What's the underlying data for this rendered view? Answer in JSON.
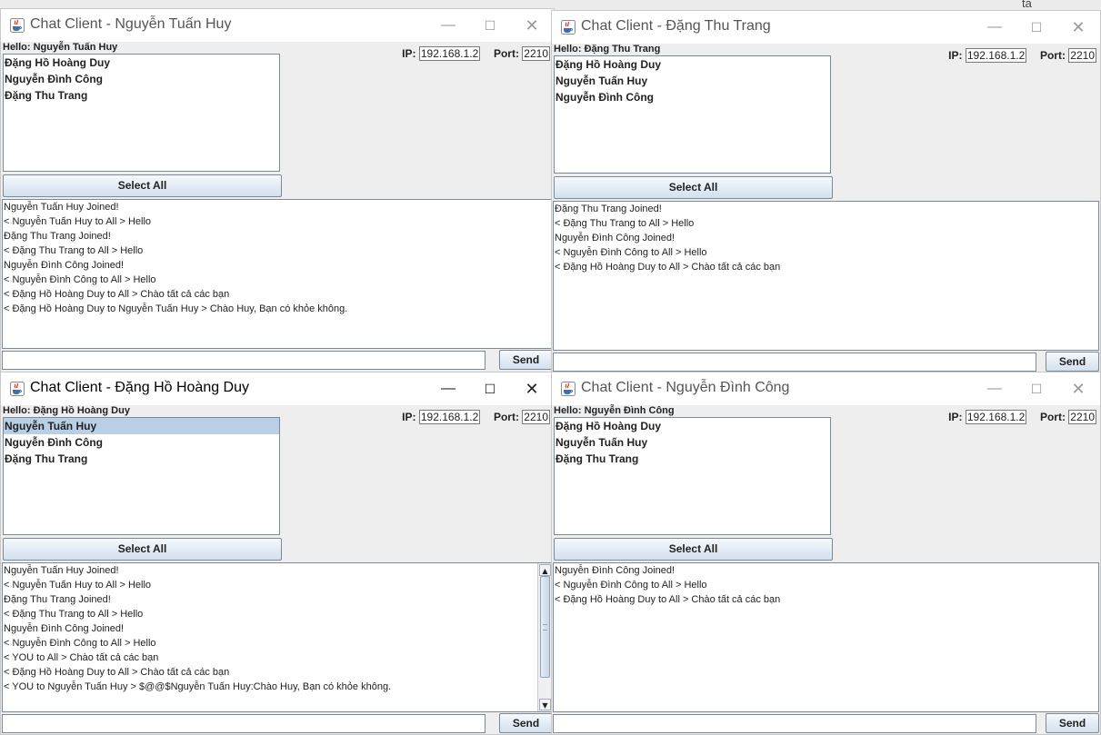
{
  "desktop": {
    "corner_text": "ta"
  },
  "windows": [
    {
      "title": "Chat Client - Nguyễn Tuấn Huy",
      "hello": "Hello: Nguyễn Tuấn Huy",
      "ip_label": "IP:",
      "ip_value": "192.168.1.2",
      "port_label": "Port:",
      "port_value": "2210",
      "users": [
        "Đặng Hồ Hoàng Duy",
        "Nguyễn Đình Công",
        "Đặng Thu Trang"
      ],
      "select_all_label": "Select All",
      "log": [
        "Nguyễn Tuấn Huy Joined!",
        "< Nguyễn Tuấn Huy to All > Hello",
        "Đặng Thu Trang Joined!",
        "< Đặng Thu Trang to All > Hello",
        "Nguyễn Đình Công Joined!",
        "< Nguyễn Đình Công to All > Hello",
        "< Đặng Hồ Hoàng Duy to All > Chào tất cả các bạn",
        "< Đặng Hồ Hoàng Duy to Nguyễn Tuấn Huy > Chào Huy, Bạn có khỏe không."
      ],
      "message_value": "",
      "send_label": "Send"
    },
    {
      "title": "Chat Client - Đặng Thu Trang",
      "hello": "Hello: Đặng Thu Trang",
      "ip_label": "IP:",
      "ip_value": "192.168.1.2",
      "port_label": "Port:",
      "port_value": "2210",
      "users": [
        "Đặng Hồ Hoàng Duy",
        "Nguyễn Tuấn Huy",
        "Nguyễn Đình Công"
      ],
      "select_all_label": "Select All",
      "log": [
        "Đặng Thu Trang Joined!",
        "< Đặng Thu Trang to All > Hello",
        "Nguyễn Đình Công Joined!",
        "< Nguyễn Đình Công to All > Hello",
        "< Đặng Hồ Hoàng Duy to All > Chào tất cả các bạn"
      ],
      "message_value": "",
      "send_label": "Send"
    },
    {
      "title": "Chat Client - Đặng Hồ Hoàng Duy",
      "hello": "Hello: Đặng Hồ Hoàng Duy",
      "ip_label": "IP:",
      "ip_value": "192.168.1.2",
      "port_label": "Port:",
      "port_value": "2210",
      "users": [
        "Nguyễn Tuấn Huy",
        "Nguyễn Đình Công",
        "Đặng Thu Trang"
      ],
      "selected_user": "Nguyễn Tuấn Huy",
      "select_all_label": "Select All",
      "log": [
        "Nguyễn Tuấn Huy Joined!",
        "< Nguyễn Tuấn Huy to All > Hello",
        "Đặng Thu Trang Joined!",
        "< Đặng Thu Trang to All > Hello",
        "Nguyễn Đình Công Joined!",
        "< Nguyễn Đình Công to All > Hello",
        "< YOU to All > Chào tất cả các bạn",
        "< Đặng Hồ Hoàng Duy to All > Chào tất cả các bạn",
        "< YOU to Nguyễn Tuấn Huy > $@@$Nguyễn Tuấn Huy:Chào Huy, Bạn có khỏe không."
      ],
      "message_value": "",
      "send_label": "Send"
    },
    {
      "title": "Chat Client - Nguyễn Đình Công",
      "hello": "Hello: Nguyễn Đình Công",
      "ip_label": "IP:",
      "ip_value": "192.168.1.2",
      "port_label": "Port:",
      "port_value": "2210",
      "users": [
        "Đặng Hồ Hoàng Duy",
        "Nguyễn Tuấn Huy",
        "Đặng Thu Trang"
      ],
      "select_all_label": "Select All",
      "log": [
        "Nguyễn Đình Công Joined!",
        "< Nguyễn Đình Công to All > Hello",
        "< Đặng Hồ Hoàng Duy to All > Chào tất cả các bạn"
      ],
      "message_value": "",
      "send_label": "Send"
    }
  ],
  "controls": {
    "minimize": "—",
    "maximize": "☐",
    "close": "✕"
  }
}
